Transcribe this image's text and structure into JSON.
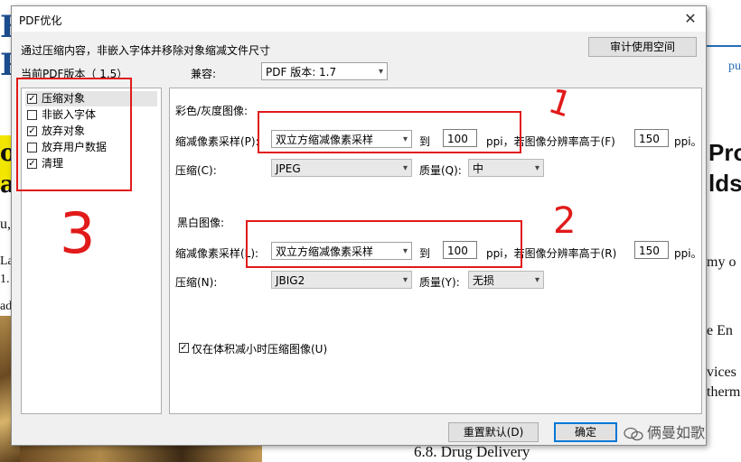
{
  "background": {
    "right_texts": [
      "pu",
      "Pro",
      "lds",
      "my o",
      "e En",
      "vices",
      "therm"
    ],
    "left_texts": [
      "H",
      "R",
      "op",
      "a",
      "u,",
      "La",
      "1.",
      "ad"
    ],
    "bottom_text": "6.8. Drug Delivery"
  },
  "dialog": {
    "title": "PDF优化",
    "close_glyph": "✕",
    "description": "通过压缩内容，非嵌入字体并移除对象缩减文件尺寸",
    "audit_button": "审计使用空间",
    "current_version": "当前PDF版本（ 1.5）",
    "compat_label": "兼容:",
    "compat_value": "PDF 版本: 1.7",
    "categories": [
      {
        "label": "压缩对象",
        "checked": true
      },
      {
        "label": "非嵌入字体",
        "checked": false
      },
      {
        "label": "放弃对象",
        "checked": true
      },
      {
        "label": "放弃用户数据",
        "checked": false
      },
      {
        "label": "清理",
        "checked": true
      }
    ],
    "color": {
      "heading": "彩色/灰度图像:",
      "resample_label": "缩减像素采样(P):",
      "resample_value": "双立方缩减像素采样",
      "to_label": "到",
      "ppi_value": "100",
      "ppi_if_label": "ppi，若图像分辨率高于(F)",
      "threshold_value": "150",
      "ppi_end": "ppi。",
      "compress_label": "压缩(C):",
      "compress_value": "JPEG",
      "quality_label": "质量(Q):",
      "quality_value": "中"
    },
    "mono": {
      "heading": "黑白图像:",
      "resample_label": "缩减像素采样(L):",
      "resample_value": "双立方缩减像素采样",
      "to_label": "到",
      "ppi_value": "100",
      "ppi_if_label": "ppi，若图像分辨率高于(R)",
      "threshold_value": "150",
      "ppi_end": "ppi。",
      "compress_label": "压缩(N):",
      "compress_value": "JBIG2",
      "quality_label": "质量(Y):",
      "quality_value": "无损"
    },
    "only_if_smaller": "仅在体积减小时压缩图像(U)",
    "only_if_smaller_checked": true,
    "reset_button": "重置默认(D)",
    "ok_button": "确定"
  },
  "annotations": [
    "1",
    "2",
    "3"
  ],
  "watermark": "俩曼如歌",
  "colors": {
    "annotation": "#e11a1a",
    "dialog_bg": "#f0f0f0",
    "focus": "#0078d7"
  }
}
